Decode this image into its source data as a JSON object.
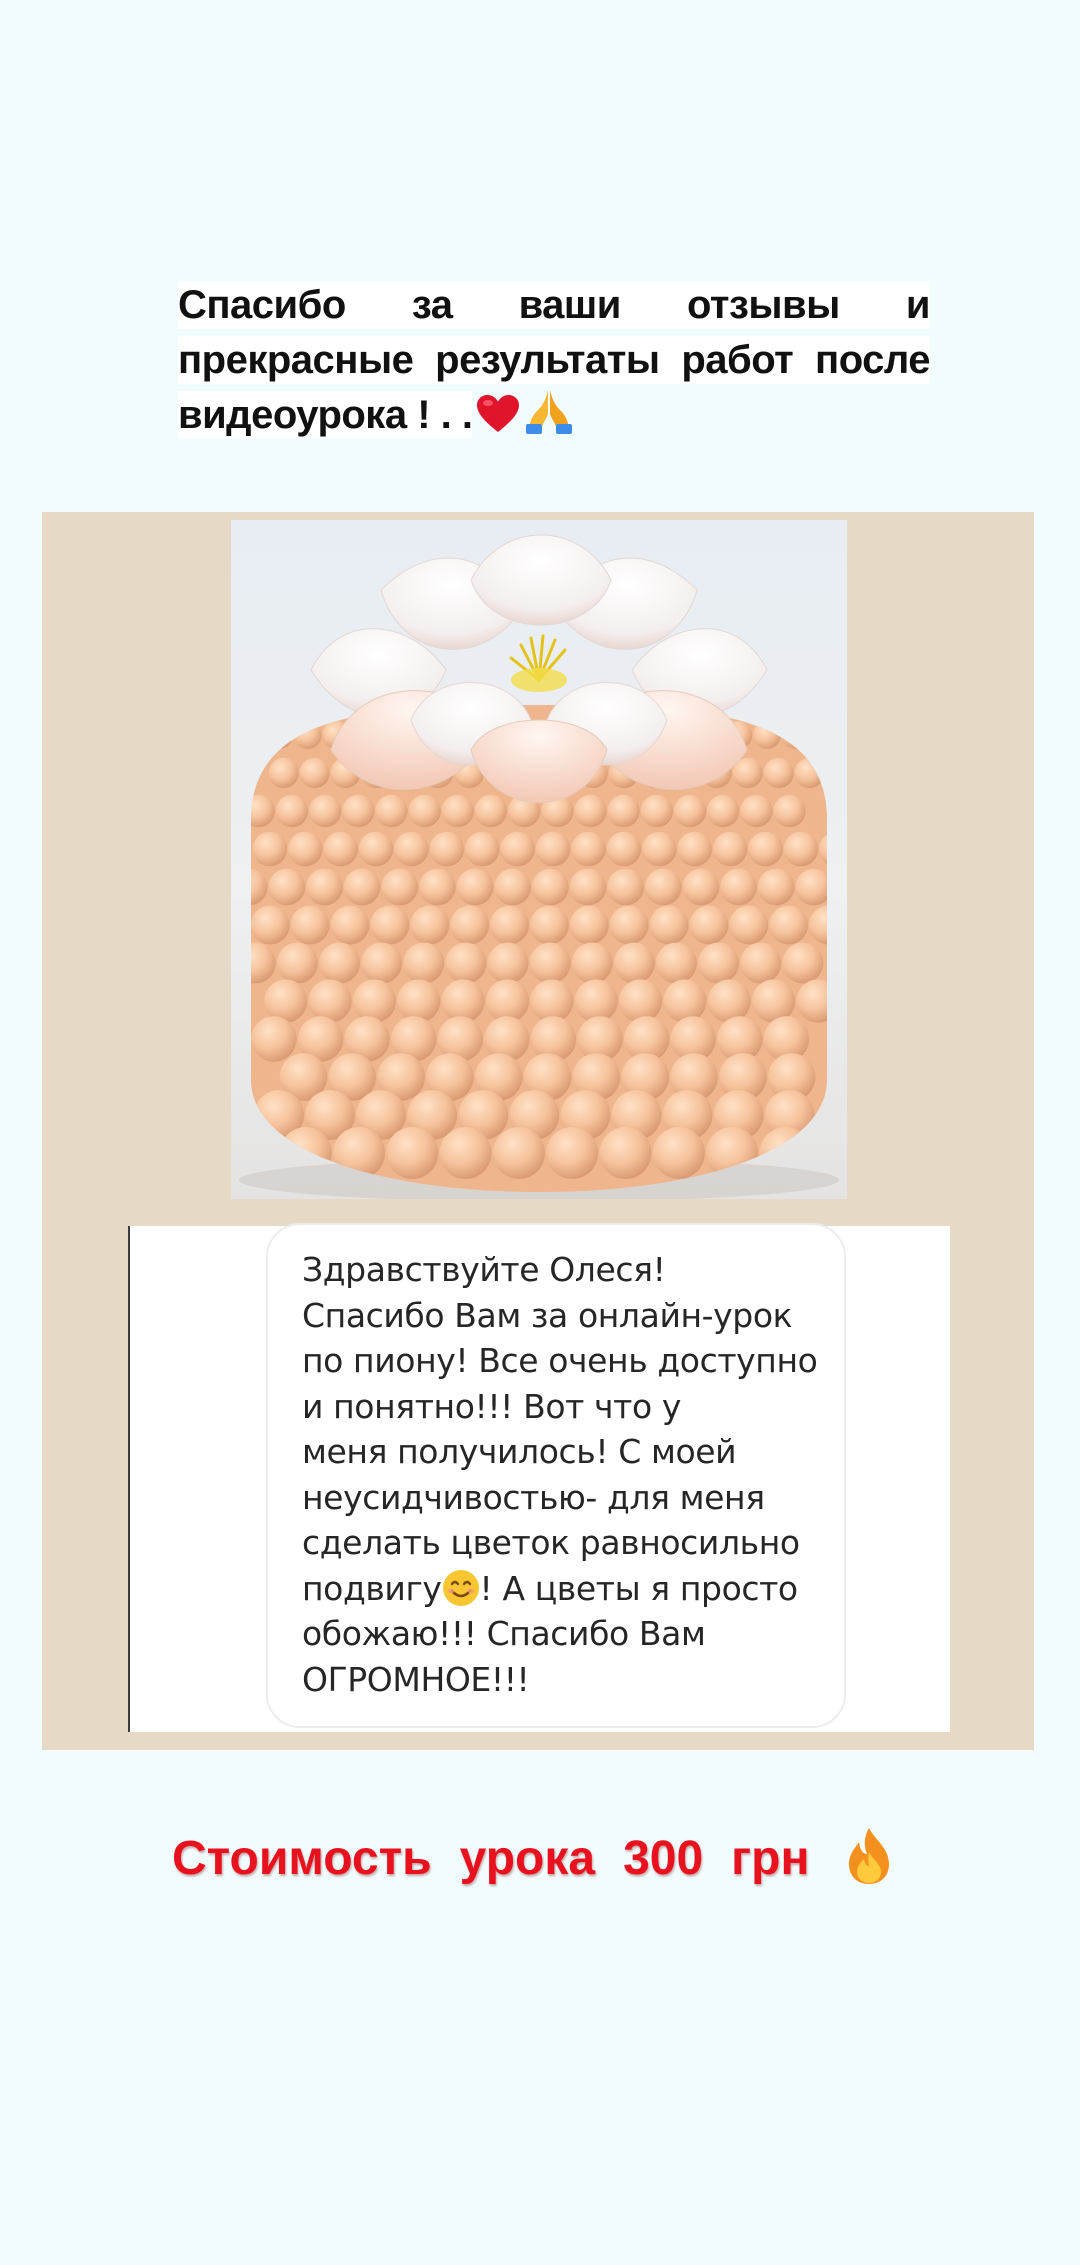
{
  "caption": {
    "text": "Спасибо  за  ваши  отзывы  и прекрасные  результаты  работ  после видеоурока  ! . .",
    "emojis": [
      "heart-icon",
      "praying-hands-icon"
    ]
  },
  "photo": {
    "subject": "cake-photo"
  },
  "review": {
    "before_emoji": "Здравствуйте Олеся!\nСпасибо Вам за онлайн-урок\nпо пиону! Все очень доступно\nи понятно!!! Вот что у\nменя получилось! С моей\nнеусидчивостью- для меня\nсделать цветок равносильно\nподвигу",
    "after_emoji": "! А цветы я просто\nобожаю!!! Спасибо Вам\nОГРОМНОЕ!!!",
    "emoji": "smiling-face-icon"
  },
  "price": {
    "word1": "Стоимость",
    "word2": "урока",
    "amount": "300",
    "currency": "грн",
    "emoji": "fire-icon"
  },
  "colors": {
    "background": "#f1fcfe",
    "panel": "#e6dac6",
    "price_red": "#e8121e",
    "cake_peach": "#f6c39c"
  }
}
